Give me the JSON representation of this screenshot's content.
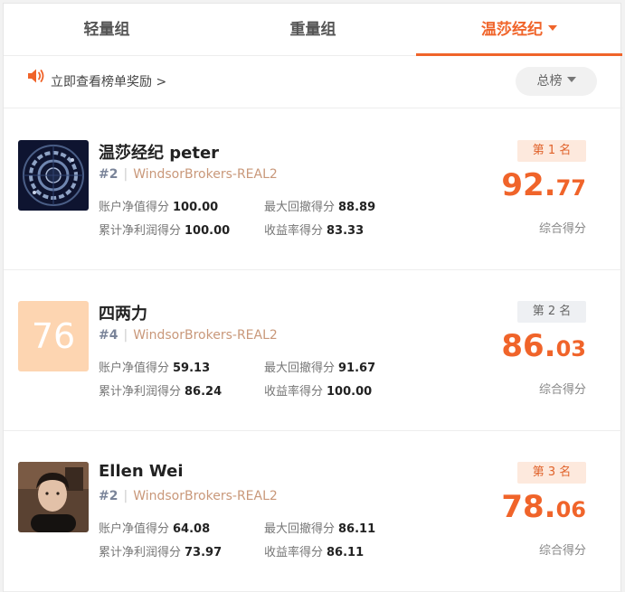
{
  "tabs": [
    {
      "label": "轻量组"
    },
    {
      "label": "重量组"
    },
    {
      "label": "温莎经纪"
    }
  ],
  "notice": {
    "text": "立即查看榜单奖励 >",
    "icon": "speaker-icon"
  },
  "board_select": {
    "label": "总榜"
  },
  "colors": {
    "accent": "#f0642a",
    "server": "#c9987a"
  },
  "entries": [
    {
      "name": "温莎经纪 peter",
      "rank": "#2",
      "server": "WindsorBrokers-REAL2",
      "metrics": {
        "equity_label": "账户净值得分",
        "equity": "100.00",
        "drawdown_label": "最大回撤得分",
        "drawdown": "88.89",
        "profit_label": "累计净利润得分",
        "profit": "100.00",
        "return_label": "收益率得分",
        "return": "83.33"
      },
      "place": "第 1 名",
      "score_int": "92.",
      "score_dec": "77",
      "score_label": "综合得分"
    },
    {
      "name": "四两力",
      "avatar_text": "76",
      "rank": "#4",
      "server": "WindsorBrokers-REAL2",
      "metrics": {
        "equity_label": "账户净值得分",
        "equity": "59.13",
        "drawdown_label": "最大回撤得分",
        "drawdown": "91.67",
        "profit_label": "累计净利润得分",
        "profit": "86.24",
        "return_label": "收益率得分",
        "return": "100.00"
      },
      "place": "第 2 名",
      "score_int": "86.",
      "score_dec": "03",
      "score_label": "综合得分"
    },
    {
      "name": "Ellen Wei",
      "rank": "#2",
      "server": "WindsorBrokers-REAL2",
      "metrics": {
        "equity_label": "账户净值得分",
        "equity": "64.08",
        "drawdown_label": "最大回撤得分",
        "drawdown": "86.11",
        "profit_label": "累计净利润得分",
        "profit": "73.97",
        "return_label": "收益率得分",
        "return": "86.11"
      },
      "place": "第 3 名",
      "score_int": "78.",
      "score_dec": "06",
      "score_label": "综合得分"
    }
  ]
}
